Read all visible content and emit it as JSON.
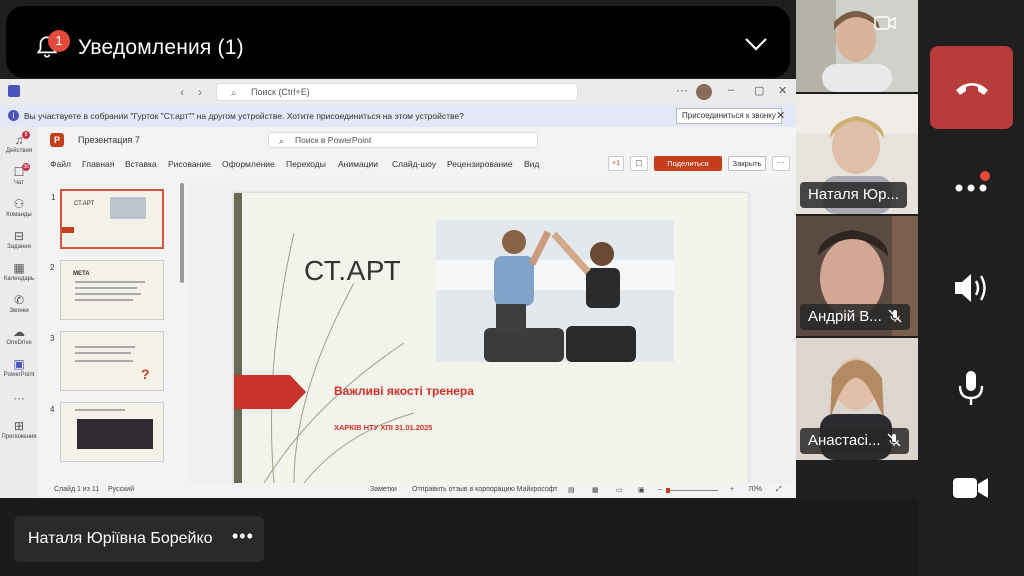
{
  "notification": {
    "title": "Уведомления (1)",
    "badge_count": "1"
  },
  "teams": {
    "search_placeholder": "Поиск (Ctrl+E)",
    "banner_text": "Вы участвуете в собрании \"Гурток \"Ст.арт\"\" на другом устройстве. Хотите присоединиться на этом устройстве?",
    "join_button": "Присоединиться к звонку",
    "rail": [
      {
        "label": "Действия",
        "badge": "8"
      },
      {
        "label": "Чат",
        "badge": "36"
      },
      {
        "label": "Команды",
        "badge": ""
      },
      {
        "label": "Задания",
        "badge": ""
      },
      {
        "label": "Календарь",
        "badge": ""
      },
      {
        "label": "Звонки",
        "badge": ""
      },
      {
        "label": "OneDrive",
        "badge": ""
      },
      {
        "label": "PowerPoint",
        "badge": ""
      },
      {
        "label": "Приложения",
        "badge": ""
      }
    ]
  },
  "powerpoint": {
    "file_name": "Презентация 7",
    "search_placeholder": "Поиск в PowerPoint",
    "menu": [
      "Файл",
      "Главная",
      "Вставка",
      "Рисование",
      "Оформление",
      "Переходы",
      "Анимации",
      "Слайд-шоу",
      "Рецензирование",
      "Вид"
    ],
    "share_button": "Поделиться",
    "close_button": "Закрыть",
    "plus_label": "+1",
    "thumbnails": [
      {
        "num": "1",
        "title": "СТ.АРТ"
      },
      {
        "num": "2",
        "title": "МЕТА"
      },
      {
        "num": "3",
        "title": ""
      },
      {
        "num": "4",
        "title": ""
      }
    ],
    "slide": {
      "title": "СТ.АРТ",
      "subtitle": "Важливі якості тренера",
      "footer": "ХАРКІВ НТУ ХПІ 31.01.2025"
    },
    "status": {
      "slide_info": "Слайд 1 из 11",
      "language": "Русский",
      "notes": "Заметки",
      "feedback": "Отправить отзыв в корпорацию Майкрософт",
      "zoom": "70%"
    }
  },
  "participants": [
    {
      "name": ""
    },
    {
      "name": "Наталя Юр..."
    },
    {
      "name": "Андрій В..."
    },
    {
      "name": "Анастасі..."
    }
  ],
  "presenter_name": "Наталя Юріївна Борейко",
  "colors": {
    "hangup": "#b83c3a",
    "accent_red": "#c43e1c",
    "teams_purple": "#4b53bc"
  }
}
